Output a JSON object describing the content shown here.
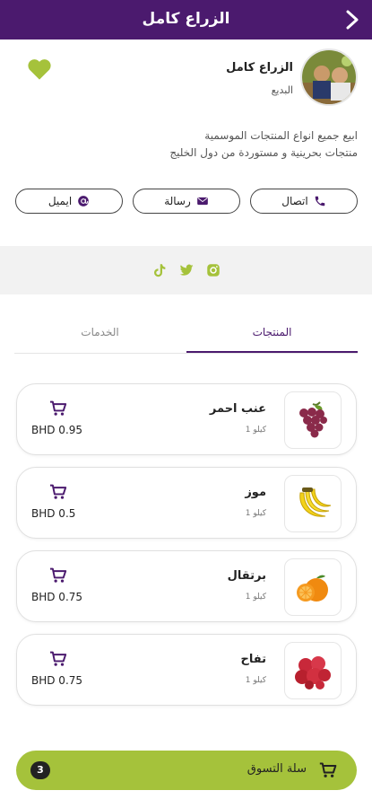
{
  "header": {
    "title": "الزراع كامل"
  },
  "profile": {
    "name": "الزراع كامل",
    "location": "البديع",
    "description_line1": "ابيع جميع انواع المنتجات الموسمية",
    "description_line2": "منتجات بحرينية و مستوردة من دول الخليج"
  },
  "contact": {
    "call": "اتصال",
    "message": "رسالة",
    "email": "ايميل"
  },
  "social": [
    "tiktok-icon",
    "twitter-icon",
    "instagram-icon"
  ],
  "tabs": {
    "products": "المنتجات",
    "services": "الخدمات"
  },
  "products": [
    {
      "name": "عنب احمر",
      "unit": "1 كيلو",
      "price": "BHD 0.95",
      "icon": "grapes-icon"
    },
    {
      "name": "موز",
      "unit": "1 كيلو",
      "price": "BHD 0.5",
      "icon": "banana-icon"
    },
    {
      "name": "برتقال",
      "unit": "1 كيلو",
      "price": "BHD 0.75",
      "icon": "orange-icon"
    },
    {
      "name": "تفاح",
      "unit": "1 كيلو",
      "price": "BHD 0.75",
      "icon": "apple-icon"
    }
  ],
  "cart": {
    "label": "سلة التسوق",
    "count": "3"
  },
  "colors": {
    "primary": "#4b1a6e",
    "accent": "#a5c23b"
  }
}
